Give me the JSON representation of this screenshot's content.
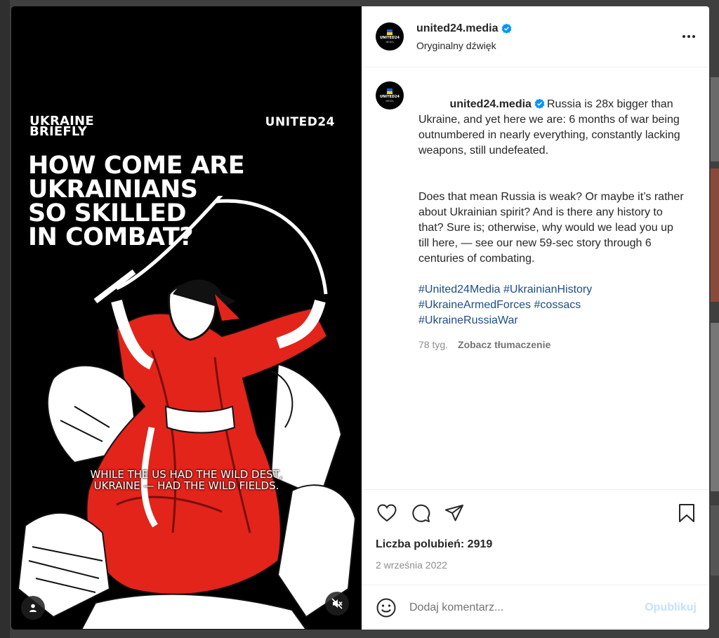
{
  "media": {
    "brand_left_line1": "UKRAINE",
    "brand_left_line2": "BRIEFLY",
    "brand_right": "UNITED24",
    "headline_lines": [
      "HOW COME ARE",
      "UKRAINIANS",
      "SO SKILLED",
      "IN COMBAT?"
    ],
    "subtitle_line1": "WHILE THE US HAD THE WILD DEST,",
    "subtitle_line2": "UKRAINE — HAD THE WILD FIELDS.",
    "user_tag_icon": "person-icon",
    "mute_icon": "speaker-muted-icon"
  },
  "header": {
    "username": "united24.media",
    "audio": "Oryginalny dźwięk",
    "avatar_text": "UNITED24",
    "avatar_sub": "MEDIA",
    "more_icon": "more-horizontal-icon"
  },
  "caption": {
    "username": "united24.media",
    "paragraph1": "Russia is 28x bigger than Ukraine, and yet here we are: 6 months of war being outnumbered in nearly everything, constantly lacking weapons, still undefeated.",
    "paragraph2": "Does that mean Russia is weak? Or maybe it’s rather about Ukrainian spirit? And is there any history to that? Sure is; otherwise, why would we lead you up till here, — see our new 59-sec story through 6 centuries of combating.",
    "hashtags": [
      "#United24Media",
      "#UkrainianHistory",
      "#UkraineArmedForces",
      "#cossacs",
      "#UkraineRussiaWar"
    ],
    "age": "78 tyg.",
    "translate": "Zobacz tłumaczenie"
  },
  "actions": {
    "like_icon": "heart-icon",
    "comment_icon": "comment-icon",
    "share_icon": "send-icon",
    "save_icon": "bookmark-icon"
  },
  "likes": "Liczba polubień: 2919",
  "date": "2 września 2022",
  "comment": {
    "placeholder": "Dodaj komentarz...",
    "publish": "Opublikuj",
    "emoji_icon": "emoji-icon"
  },
  "colors": {
    "verified": "#0095f6",
    "hashtag": "#1c4e8a",
    "publish_disabled": "#c5e1fb",
    "art_red": "#e3241b"
  }
}
